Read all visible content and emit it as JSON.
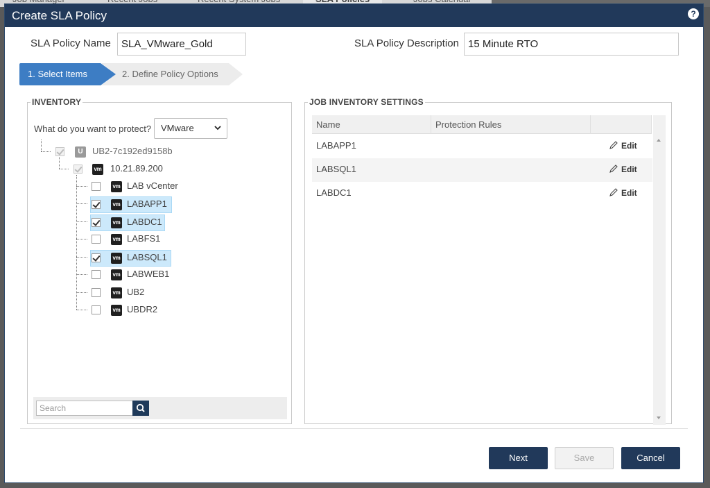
{
  "background_tabs": [
    "Job Manager",
    "Recent Jobs",
    "Recent System Jobs",
    "SLA Policies",
    "Jobs Calendar"
  ],
  "dialog": {
    "title": "Create SLA Policy",
    "help_icon": "question-circle-icon"
  },
  "form": {
    "name_label": "SLA Policy Name",
    "name_value": "SLA_VMware_Gold",
    "description_label": "SLA Policy Description",
    "description_value": "15 Minute RTO"
  },
  "wizard": {
    "step1": "1. Select Items",
    "step2": "2. Define Policy Options"
  },
  "inventory": {
    "legend": "INVENTORY",
    "protect_label": "What do you want to protect?",
    "protect_value": "VMware",
    "root": {
      "label": "UB2-7c192ed9158b",
      "icon": "appliance-icon",
      "checked": true
    },
    "host": {
      "label": "10.21.89.200",
      "icon": "vm-icon",
      "checked": true
    },
    "vms": [
      {
        "label": "LAB vCenter",
        "checked": false
      },
      {
        "label": "LABAPP1",
        "checked": true
      },
      {
        "label": "LABDC1",
        "checked": true
      },
      {
        "label": "LABFS1",
        "checked": false
      },
      {
        "label": "LABSQL1",
        "checked": true
      },
      {
        "label": "LABWEB1",
        "checked": false
      },
      {
        "label": "UB2",
        "checked": false
      },
      {
        "label": "UBDR2",
        "checked": false
      }
    ],
    "vm_icon_text": "vm",
    "root_icon_text": "U",
    "search_placeholder": "Search"
  },
  "job_inventory": {
    "legend": "JOB INVENTORY SETTINGS",
    "columns": [
      "Name",
      "Protection Rules"
    ],
    "rows": [
      {
        "name": "LABAPP1",
        "action": "Edit"
      },
      {
        "name": "LABSQL1",
        "action": "Edit"
      },
      {
        "name": "LABDC1",
        "action": "Edit"
      }
    ]
  },
  "buttons": {
    "next": "Next",
    "save": "Save",
    "cancel": "Cancel"
  },
  "colors": {
    "title_bar": "#21395a",
    "step_active": "#3d7dc4",
    "selection": "#cce9fb"
  }
}
